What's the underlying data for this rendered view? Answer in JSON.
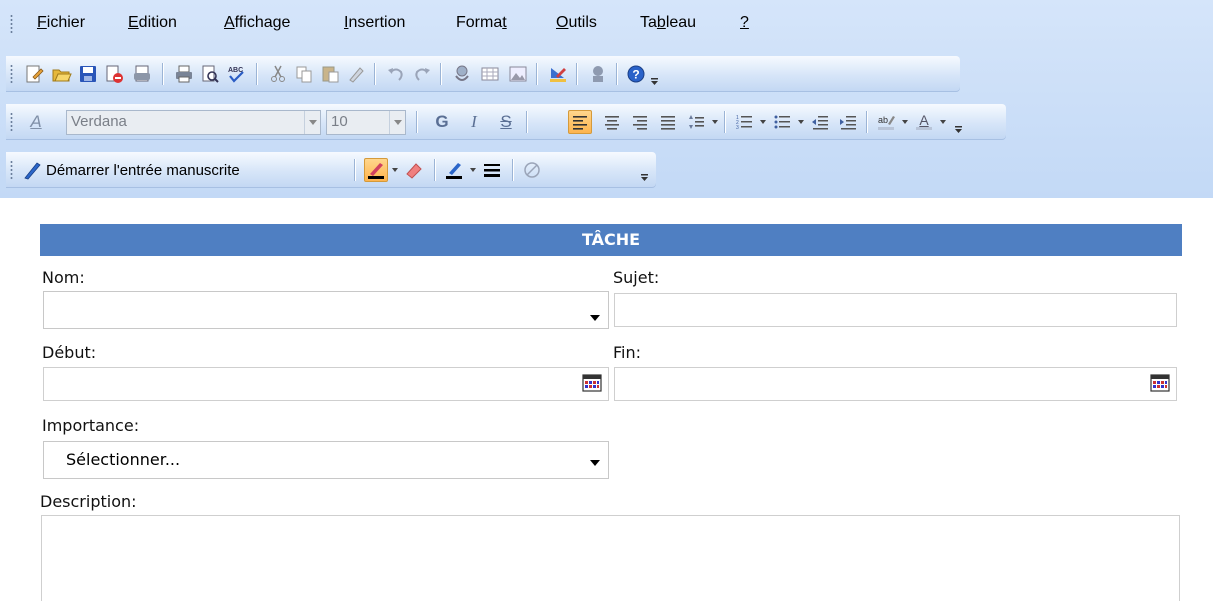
{
  "menubar": {
    "items": [
      {
        "pre": "",
        "ul": "F",
        "post": "ichier"
      },
      {
        "pre": "",
        "ul": "E",
        "post": "dition"
      },
      {
        "pre": "",
        "ul": "A",
        "post": "ffichage"
      },
      {
        "pre": "",
        "ul": "I",
        "post": "nsertion"
      },
      {
        "pre": "Forma",
        "ul": "t",
        "post": ""
      },
      {
        "pre": "",
        "ul": "O",
        "post": "utils"
      },
      {
        "pre": "Ta",
        "ul": "b",
        "post": "leau"
      },
      {
        "pre": "",
        "ul": "?",
        "post": ""
      }
    ]
  },
  "format_toolbar": {
    "font_name": "Verdana",
    "font_size": "10",
    "bold_label": "G",
    "italic_label": "I",
    "strike_label": "S"
  },
  "ink_toolbar": {
    "start_ink_label": "Démarrer l'entrée manuscrite"
  },
  "form": {
    "header": "TÂCHE",
    "nom_label": "Nom:",
    "sujet_label": "Sujet:",
    "debut_label": "Début:",
    "fin_label": "Fin:",
    "importance_label": "Importance:",
    "importance_value": "Sélectionner...",
    "description_label": "Description:",
    "nom_value": "",
    "sujet_value": "",
    "debut_value": "",
    "fin_value": "",
    "description_value": ""
  },
  "colors": {
    "toolbar_band": "#c9dcf7",
    "header_bg": "#4f7fc2",
    "header_text": "#ffffff",
    "active_button": "#fdc56a"
  }
}
